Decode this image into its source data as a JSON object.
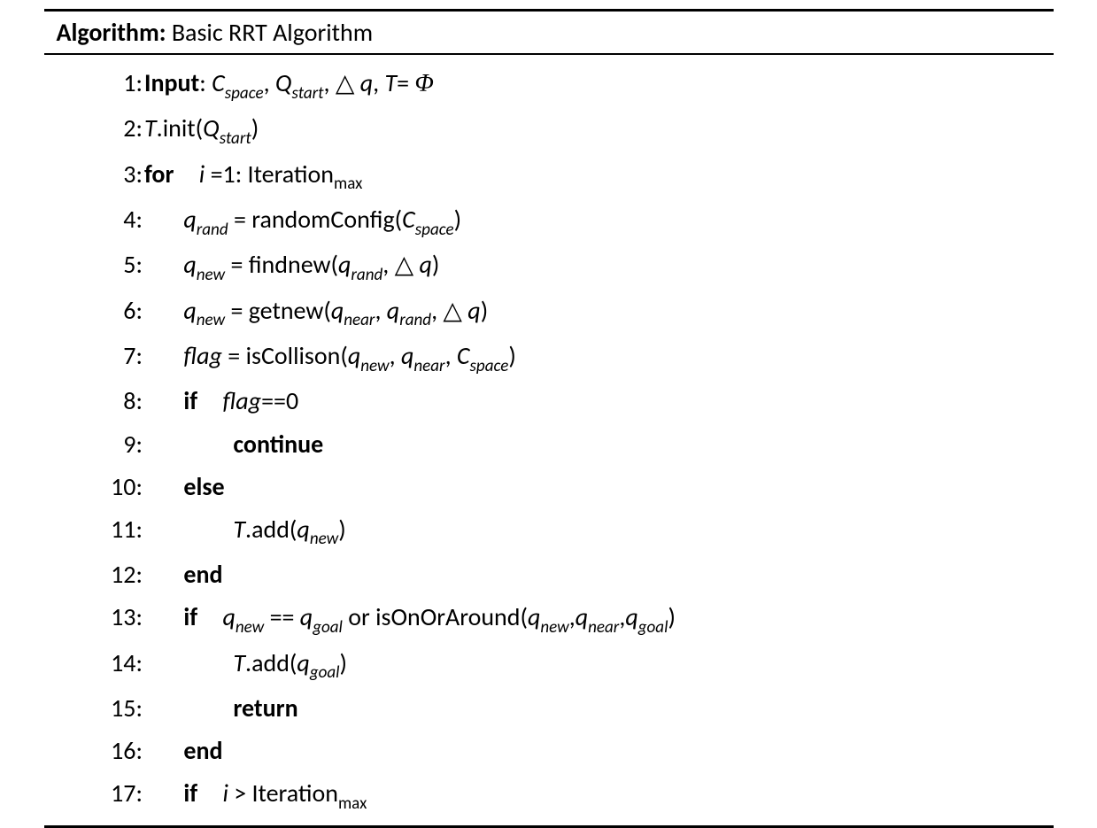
{
  "header": {
    "label": "Algorithm:",
    "title": "Basic RRT Algorithm"
  },
  "sym": {
    "Cspace_C": "C",
    "Cspace_sub": "space",
    "Qstart_Q": "Q",
    "Qstart_sub": "start",
    "deltaq_delta": "△",
    "deltaq_q": "q",
    "T": "T",
    "Phi": "Φ",
    "i": "i",
    "Iteration": "Iteration",
    "Iteration_sub": "max",
    "q": "q",
    "rand": "rand",
    "new": "new",
    "near": "near",
    "goal": "goal",
    "flag": "flag"
  },
  "kw": {
    "Input": "Input",
    "for": "for",
    "if": "if",
    "else": "else",
    "end": "end",
    "continue": "continue",
    "return": "return"
  },
  "fn": {
    "init": ".init(",
    "randomConfig": "randomConfig(",
    "findnew": "findnew(",
    "getnew": "getnew(",
    "isCollison": "isCollison(",
    "add": ".add(",
    "isOnOrAround": "isOnOrAround("
  },
  "txt": {
    "eq": " = ",
    "eqeq": "==",
    "eq1colon": " =1: ",
    "zero": "0",
    "or": " or ",
    "gt": " > ",
    "comma": ", ",
    "comma_ns": ",",
    "close": ")",
    "Teq": "=",
    "sp": " "
  },
  "nums": [
    "1",
    "2",
    "3",
    "4",
    "5",
    "6",
    "7",
    "8",
    "9",
    "10",
    "11",
    "12",
    "13",
    "14",
    "15",
    "16",
    "17"
  ]
}
